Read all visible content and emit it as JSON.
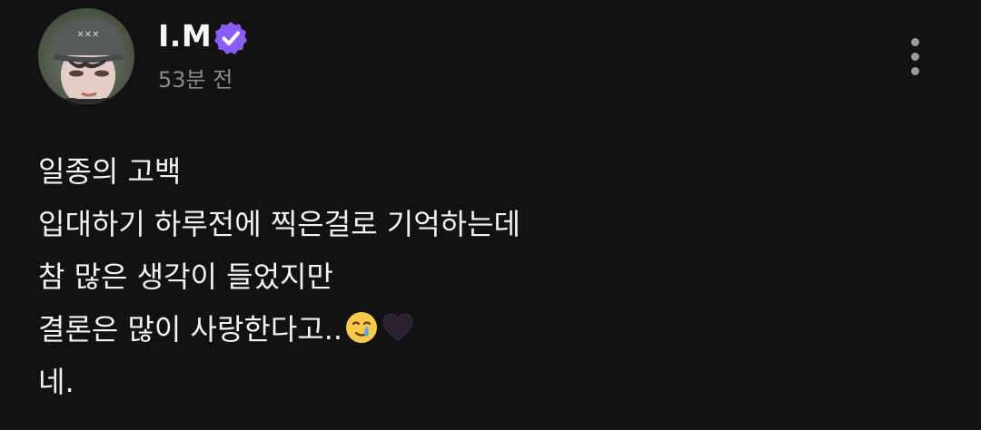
{
  "post": {
    "author": {
      "name": "I.M",
      "verified_badge_icon": "verified-check-icon",
      "avatar_icon": "user-avatar-photo"
    },
    "timestamp": "53분 전",
    "more_icon": "vertical-ellipsis-icon",
    "lines": [
      "일종의 고백",
      "입대하기 하루전에 찍은걸로 기억하는데",
      "참 많은 생각이 들었지만",
      "결론은 많이 사랑한다고..",
      "네."
    ],
    "emojis": [
      "smiling-face-with-tear-emoji",
      "black-heart-emoji"
    ]
  },
  "colors": {
    "background": "#121212",
    "text": "#f2f2f2",
    "muted_text": "#8a8a8a",
    "verified_badge": "#8b5cf6"
  }
}
